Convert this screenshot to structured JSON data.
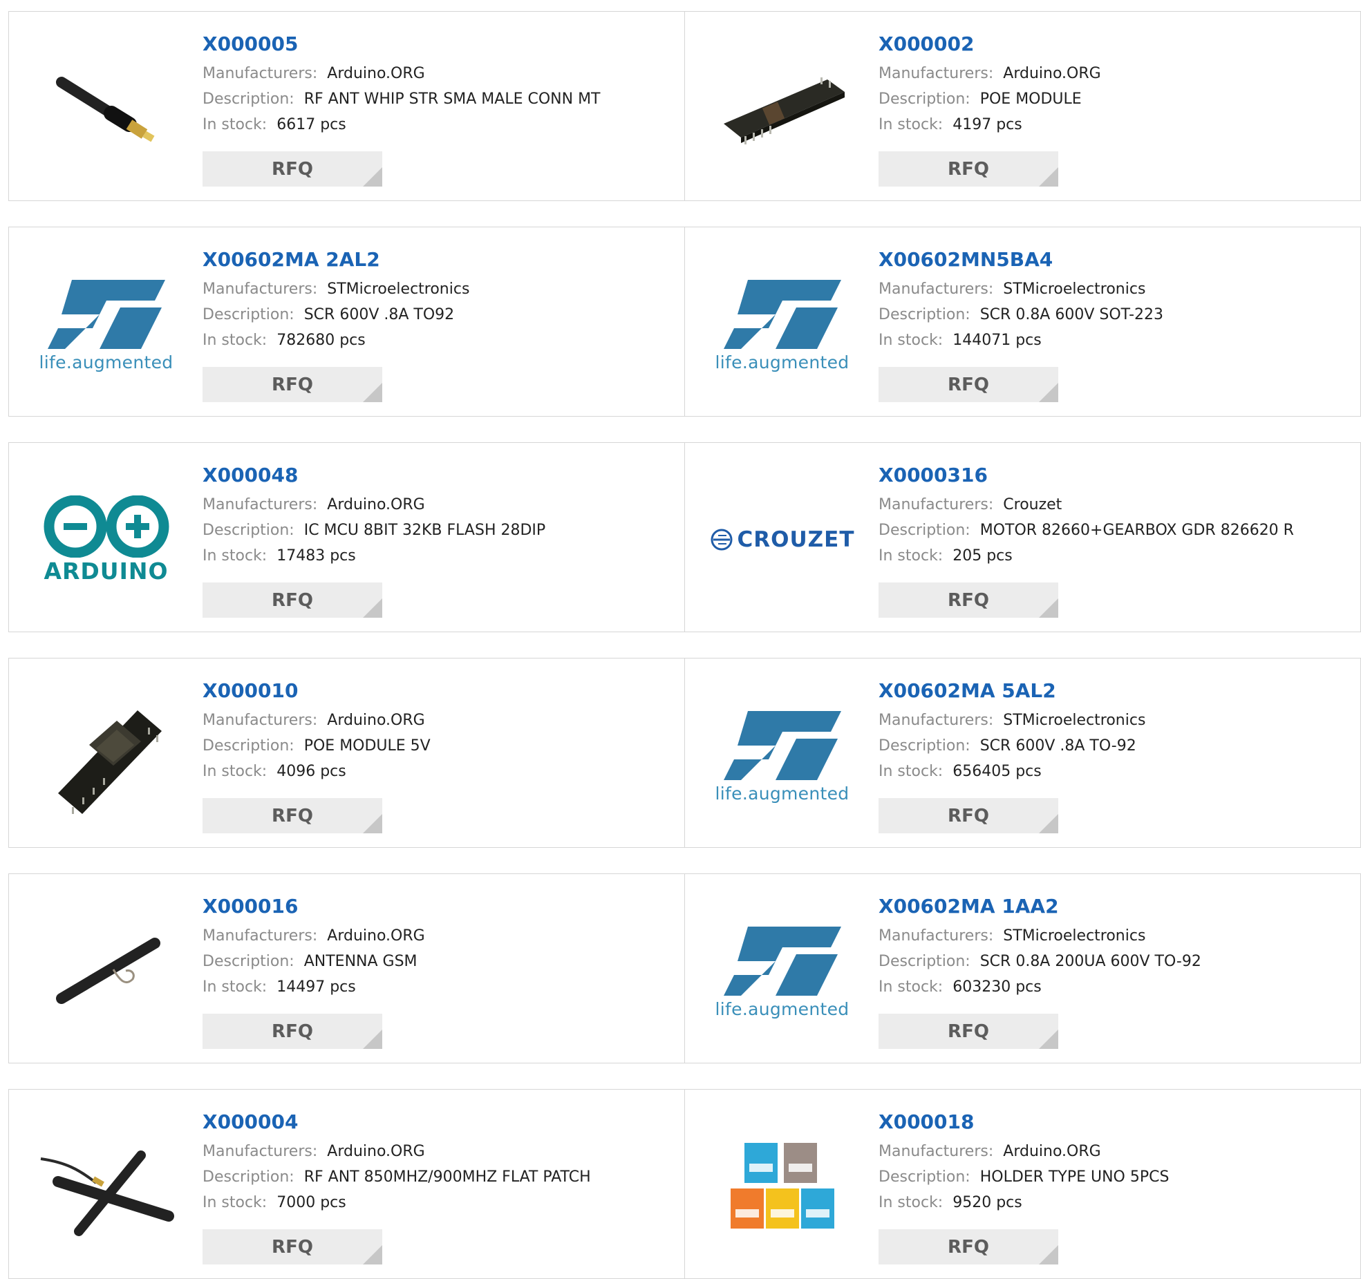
{
  "labels": {
    "manufacturers": "Manufacturers:",
    "description": "Description:",
    "in_stock": "In stock:",
    "rfq": "RFQ"
  },
  "products": [
    {
      "part": "X000005",
      "manufacturer": "Arduino.ORG",
      "description": "RF ANT WHIP STR SMA MALE CONN MT",
      "stock": "6617 pcs",
      "image": "whip-antenna-image"
    },
    {
      "part": "X000002",
      "manufacturer": "Arduino.ORG",
      "description": "POE MODULE",
      "stock": "4197 pcs",
      "image": "poe-module-image"
    },
    {
      "part": "X00602MA 2AL2",
      "manufacturer": "STMicroelectronics",
      "description": "SCR 600V .8A TO92",
      "stock": "782680 pcs",
      "image": "st-logo"
    },
    {
      "part": "X00602MN5BA4",
      "manufacturer": "STMicroelectronics",
      "description": "SCR 0.8A 600V SOT-223",
      "stock": "144071 pcs",
      "image": "st-logo"
    },
    {
      "part": "X000048",
      "manufacturer": "Arduino.ORG",
      "description": "IC MCU 8BIT 32KB FLASH 28DIP",
      "stock": "17483 pcs",
      "image": "arduino-logo"
    },
    {
      "part": "X0000316",
      "manufacturer": "Crouzet",
      "description": "MOTOR 82660+GEARBOX GDR 826620 R",
      "stock": "205 pcs",
      "image": "crouzet-logo"
    },
    {
      "part": "X000010",
      "manufacturer": "Arduino.ORG",
      "description": "POE MODULE 5V",
      "stock": "4096 pcs",
      "image": "poe-module-5v-image"
    },
    {
      "part": "X00602MA 5AL2",
      "manufacturer": "STMicroelectronics",
      "description": "SCR 600V .8A TO-92",
      "stock": "656405 pcs",
      "image": "st-logo"
    },
    {
      "part": "X000016",
      "manufacturer": "Arduino.ORG",
      "description": "ANTENNA GSM",
      "stock": "14497 pcs",
      "image": "gsm-antenna-image"
    },
    {
      "part": "X00602MA 1AA2",
      "manufacturer": "STMicroelectronics",
      "description": "SCR 0.8A 200UA 600V TO-92",
      "stock": "603230 pcs",
      "image": "st-logo"
    },
    {
      "part": "X000004",
      "manufacturer": "Arduino.ORG",
      "description": "RF ANT 850MHZ/900MHZ FLAT PATCH",
      "stock": "7000 pcs",
      "image": "flat-patch-antenna-image"
    },
    {
      "part": "X000018",
      "manufacturer": "Arduino.ORG",
      "description": "HOLDER TYPE UNO 5PCS",
      "stock": "9520 pcs",
      "image": "uno-holder-image"
    }
  ],
  "logos": {
    "st_tagline_a": "life",
    "st_tagline_dot": ".",
    "st_tagline_b": "augmented",
    "arduino": "ARDUINO",
    "crouzet": "CROUZET"
  },
  "colors": {
    "part_link": "#1a63b4",
    "label_gray": "#8a8a8a",
    "value_text": "#222222",
    "rfq_bg": "#ececec",
    "rfq_text": "#5c5c5c",
    "border": "#d6d6d6",
    "st_blue": "#2f7aa8",
    "arduino_teal": "#0f8a93",
    "crouzet_blue": "#1f5ca8"
  }
}
